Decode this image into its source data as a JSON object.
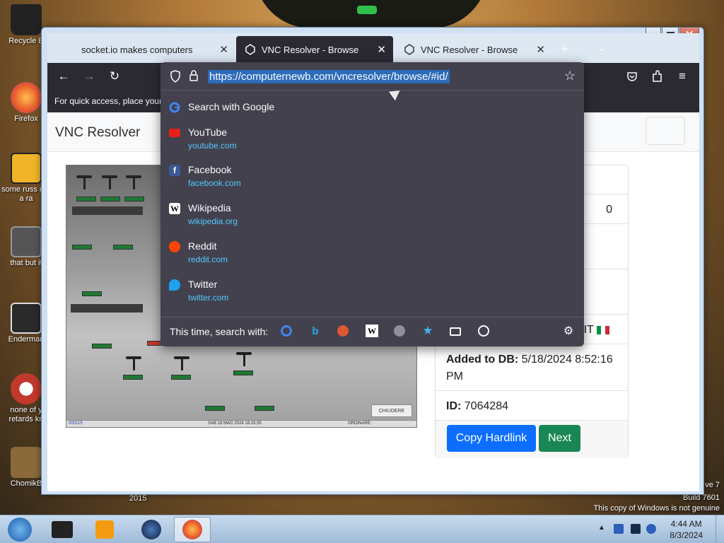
{
  "desktop": {
    "icons": [
      {
        "label": "Recycle B",
        "color": "#222222"
      },
      {
        "label": "Firefox",
        "color": "#e8572a"
      },
      {
        "label": "some russ ran a ra",
        "color": "#f0b428"
      },
      {
        "label": "that but it",
        "color": "#6a6a6a"
      },
      {
        "label": "Enderman",
        "color": "#2a2a2a"
      },
      {
        "label": "none of y retards kn",
        "color": "#c0392b"
      },
      {
        "label": "ChomikB",
        "color": "#8a6a3a"
      }
    ],
    "year_text": "2015",
    "windows_version": "ve 7",
    "build_text": "Build 7601",
    "genuine_text": "This copy of Windows is not genuine"
  },
  "browser": {
    "tabs": [
      {
        "label": "socket.io makes computers",
        "active": false
      },
      {
        "label": "VNC Resolver - Browse",
        "active": true
      },
      {
        "label": "VNC Resolver - Browse",
        "active": false
      }
    ],
    "new_tab_icon": "plus-icon",
    "bookmarks_bar_text": "For quick access, place your b",
    "url": "https://computernewb.com/vncresolver/browse/#id/"
  },
  "dropdown": {
    "first_suggestion": "Search with Google",
    "suggestions": [
      {
        "title": "YouTube",
        "url": "youtube.com",
        "icon": "youtube-icon",
        "color": "#e62117"
      },
      {
        "title": "Facebook",
        "url": "facebook.com",
        "icon": "facebook-icon",
        "color": "#3b5998"
      },
      {
        "title": "Wikipedia",
        "url": "wikipedia.org",
        "icon": "wikipedia-icon",
        "color": "#ffffff"
      },
      {
        "title": "Reddit",
        "url": "reddit.com",
        "icon": "reddit-icon",
        "color": "#ff4500"
      },
      {
        "title": "Twitter",
        "url": "twitter.com",
        "icon": "twitter-icon",
        "color": "#1da1f2"
      }
    ],
    "search_with_label": "This time, search with:",
    "engines": [
      "google-icon",
      "bing-icon",
      "duckduckgo-icon",
      "wikipedia-icon",
      "search-icon",
      "bookmarks-star-icon",
      "tabs-icon",
      "history-icon"
    ]
  },
  "page": {
    "brand": "VNC Resolver",
    "partial_value_1": "0",
    "country_code": "IT",
    "added_label": "Added to DB:",
    "added_value": "5/18/2024 8:52:16 PM",
    "id_label": "ID:",
    "id_value": "7064284",
    "copy_button": "Copy Hardlink",
    "next_button": "Next",
    "screenshot": {
      "button_text": "CHIUDERE",
      "status_left": "000115",
      "status_center": "SAB 18 MAG 2024 18:23:35",
      "status_right": "ORDINARE:"
    }
  },
  "taskbar": {
    "time": "4:44 AM",
    "date": "8/3/2024"
  }
}
